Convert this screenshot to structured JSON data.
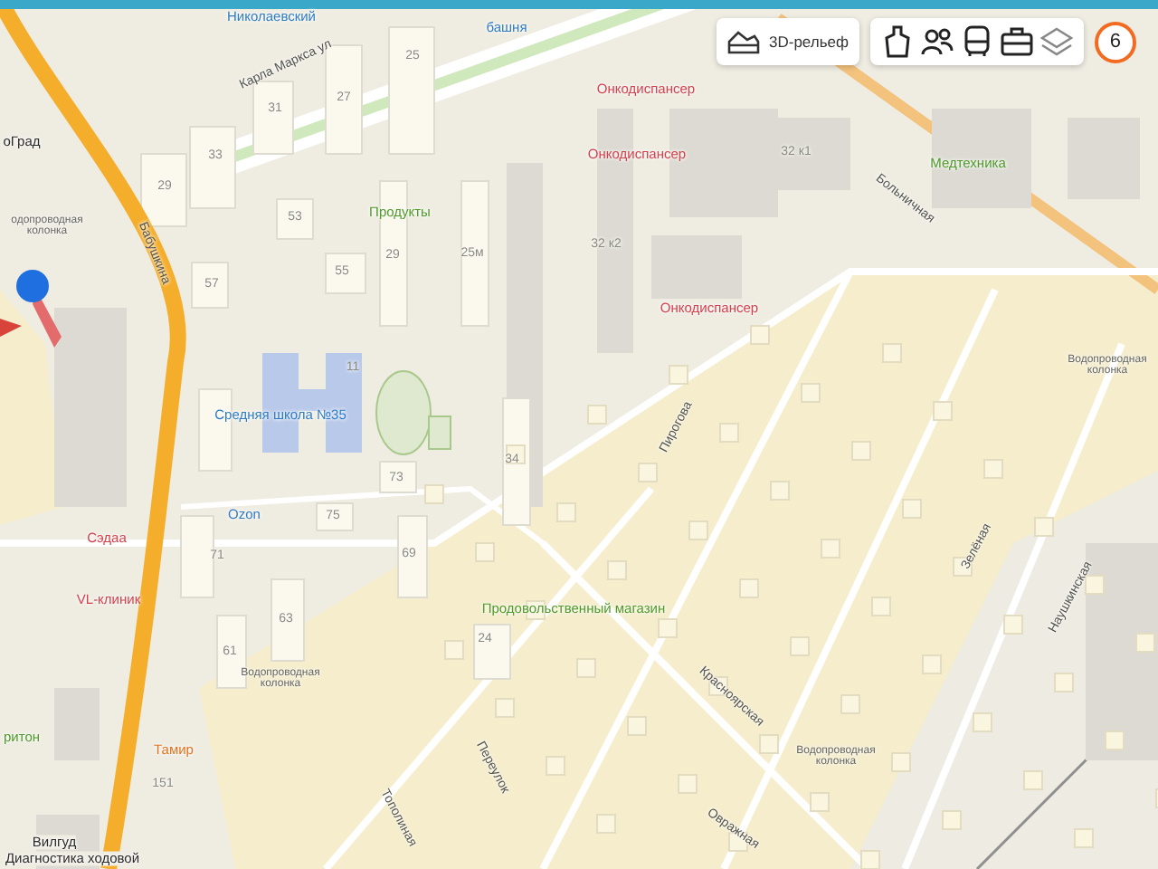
{
  "toolbar": {
    "relief_button": "3D-рельеф",
    "icon_buttons": [
      {
        "kind": "attractions"
      },
      {
        "kind": "people"
      },
      {
        "kind": "transport"
      },
      {
        "kind": "business"
      },
      {
        "kind": "layers"
      }
    ],
    "badge": "6"
  },
  "map": {
    "labels": [
      {
        "text": "Николаевский",
        "kind": "transit"
      },
      {
        "text": "башня",
        "kind": "transit"
      },
      {
        "text": "Карла Маркса ул",
        "kind": "street"
      },
      {
        "text": "25",
        "kind": "house"
      },
      {
        "text": "Онкодиспансер",
        "kind": "medical"
      },
      {
        "text": "27",
        "kind": "house"
      },
      {
        "text": "31",
        "kind": "house"
      },
      {
        "text": "оГрад",
        "kind": "place"
      },
      {
        "text": "33",
        "kind": "house"
      },
      {
        "text": "Онкодиспансер",
        "kind": "medical"
      },
      {
        "text": "32 к1",
        "kind": "house"
      },
      {
        "text": "Медтехника",
        "kind": "shop"
      },
      {
        "text": "29",
        "kind": "house"
      },
      {
        "text": "одопроводная колонка",
        "kind": "note"
      },
      {
        "text": "53",
        "kind": "house"
      },
      {
        "text": "Продукты",
        "kind": "shop"
      },
      {
        "text": "Больничная",
        "kind": "street"
      },
      {
        "text": "Бабушкина",
        "kind": "street"
      },
      {
        "text": "29",
        "kind": "house"
      },
      {
        "text": "25м",
        "kind": "house"
      },
      {
        "text": "32 к2",
        "kind": "house"
      },
      {
        "text": "57",
        "kind": "house"
      },
      {
        "text": "55",
        "kind": "house"
      },
      {
        "text": "Онкодиспансер",
        "kind": "medical"
      },
      {
        "text": "11",
        "kind": "house"
      },
      {
        "text": "Водопроводная колонка",
        "kind": "note"
      },
      {
        "text": "Средняя школа №35",
        "kind": "education"
      },
      {
        "text": "Пирогова",
        "kind": "street"
      },
      {
        "text": "34",
        "kind": "house"
      },
      {
        "text": "73",
        "kind": "house"
      },
      {
        "text": "Ozon",
        "kind": "education"
      },
      {
        "text": "75",
        "kind": "house"
      },
      {
        "text": "Сэдаа",
        "kind": "medical"
      },
      {
        "text": "71",
        "kind": "house"
      },
      {
        "text": "69",
        "kind": "house"
      },
      {
        "text": "Зелёная",
        "kind": "street"
      },
      {
        "text": "VL-клиник",
        "kind": "medical"
      },
      {
        "text": "63",
        "kind": "house"
      },
      {
        "text": "Продовольственный магазин",
        "kind": "shop"
      },
      {
        "text": "61",
        "kind": "house"
      },
      {
        "text": "24",
        "kind": "house"
      },
      {
        "text": "Наушкинская",
        "kind": "street"
      },
      {
        "text": "Водопроводная колонка",
        "kind": "note"
      },
      {
        "text": "ритон",
        "kind": "shop"
      },
      {
        "text": "Тамир",
        "kind": "food"
      },
      {
        "text": "151",
        "kind": "house"
      },
      {
        "text": "Вилгуд",
        "kind": "place"
      },
      {
        "text": "Диагностика ходовой",
        "kind": "place"
      },
      {
        "text": "Тополиная",
        "kind": "street"
      },
      {
        "text": "Переулок",
        "kind": "street"
      },
      {
        "text": "Красноярская",
        "kind": "street"
      },
      {
        "text": "Водопроводная колонка",
        "kind": "note"
      },
      {
        "text": "Овражная",
        "kind": "street"
      }
    ]
  }
}
